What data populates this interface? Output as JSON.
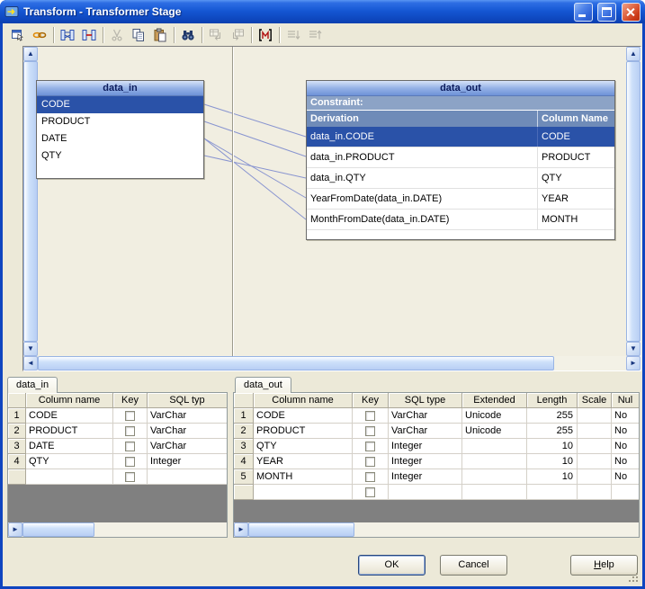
{
  "window": {
    "title": "Transform - Transformer Stage"
  },
  "icons": {
    "scroll_up": "▲",
    "scroll_down": "▼",
    "scroll_left": "◄",
    "scroll_right": "►"
  },
  "toolbar": {
    "buttons": [
      {
        "name": "stage-properties",
        "enabled": true
      },
      {
        "name": "constraints",
        "enabled": true
      },
      {
        "name": "show-all-relations",
        "enabled": true
      },
      {
        "name": "show-selected-relations",
        "enabled": true
      },
      {
        "name": "cut",
        "enabled": false
      },
      {
        "name": "copy",
        "enabled": true
      },
      {
        "name": "paste",
        "enabled": true
      },
      {
        "name": "find-replace",
        "enabled": true
      },
      {
        "name": "load-column-definition",
        "enabled": false
      },
      {
        "name": "save-column-definition",
        "enabled": false
      },
      {
        "name": "column-auto-match",
        "enabled": true
      },
      {
        "name": "input-link-execution-order",
        "enabled": false
      },
      {
        "name": "output-link-execution-order",
        "enabled": false
      }
    ]
  },
  "canvas": {
    "input_table": {
      "title": "data_in",
      "columns": [
        "CODE",
        "PRODUCT",
        "DATE",
        "QTY"
      ],
      "selected_column": "CODE"
    },
    "output_table": {
      "title": "data_out",
      "constraint_label": "Constraint:",
      "derivation_header": "Derivation",
      "column_name_header": "Column Name",
      "rows": [
        {
          "derivation": "data_in.CODE",
          "column_name": "CODE",
          "selected": true
        },
        {
          "derivation": "data_in.PRODUCT",
          "column_name": "PRODUCT",
          "selected": false
        },
        {
          "derivation": "data_in.QTY",
          "column_name": "QTY",
          "selected": false
        },
        {
          "derivation": "YearFromDate(data_in.DATE)",
          "column_name": "YEAR",
          "selected": false
        },
        {
          "derivation": "MonthFromDate(data_in.DATE)",
          "column_name": "MONTH",
          "selected": false
        }
      ]
    },
    "links": [
      {
        "from": "CODE",
        "to": "CODE"
      },
      {
        "from": "PRODUCT",
        "to": "PRODUCT"
      },
      {
        "from": "DATE",
        "to": "YEAR"
      },
      {
        "from": "DATE",
        "to": "MONTH"
      },
      {
        "from": "QTY",
        "to": "QTY"
      }
    ]
  },
  "input_grid": {
    "tab": "data_in",
    "headers": [
      "Column name",
      "Key",
      "SQL typ"
    ],
    "rows": [
      {
        "num": "1",
        "name": "CODE",
        "key_checked": false,
        "sql_type": "VarChar"
      },
      {
        "num": "2",
        "name": "PRODUCT",
        "key_checked": false,
        "sql_type": "VarChar"
      },
      {
        "num": "3",
        "name": "DATE",
        "key_checked": false,
        "sql_type": "VarChar"
      },
      {
        "num": "4",
        "name": "QTY",
        "key_checked": false,
        "sql_type": "Integer"
      }
    ]
  },
  "output_grid": {
    "tab": "data_out",
    "headers": [
      "Column name",
      "Key",
      "SQL type",
      "Extended",
      "Length",
      "Scale",
      "Nul"
    ],
    "rows": [
      {
        "num": "1",
        "name": "CODE",
        "key_checked": false,
        "sql_type": "VarChar",
        "extended": "Unicode",
        "length": "255",
        "scale": "",
        "nullable": "No"
      },
      {
        "num": "2",
        "name": "PRODUCT",
        "key_checked": false,
        "sql_type": "VarChar",
        "extended": "Unicode",
        "length": "255",
        "scale": "",
        "nullable": "No"
      },
      {
        "num": "3",
        "name": "QTY",
        "key_checked": false,
        "sql_type": "Integer",
        "extended": "",
        "length": "10",
        "scale": "",
        "nullable": "No"
      },
      {
        "num": "4",
        "name": "YEAR",
        "key_checked": false,
        "sql_type": "Integer",
        "extended": "",
        "length": "10",
        "scale": "",
        "nullable": "No"
      },
      {
        "num": "5",
        "name": "MONTH",
        "key_checked": false,
        "sql_type": "Integer",
        "extended": "",
        "length": "10",
        "scale": "",
        "nullable": "No"
      }
    ]
  },
  "footer": {
    "ok": "OK",
    "cancel": "Cancel",
    "help": "Help"
  },
  "colors": {
    "dialog_bg": "#ECE9D8",
    "canvas_bg": "#F1EEE1",
    "selection_blue": "#2A52A8",
    "table_header_steel": "#6F8BB8",
    "constraint_blue": "#8CA3C6",
    "titlebar_blue": "#1456D2",
    "link_line": "#8894D0"
  }
}
